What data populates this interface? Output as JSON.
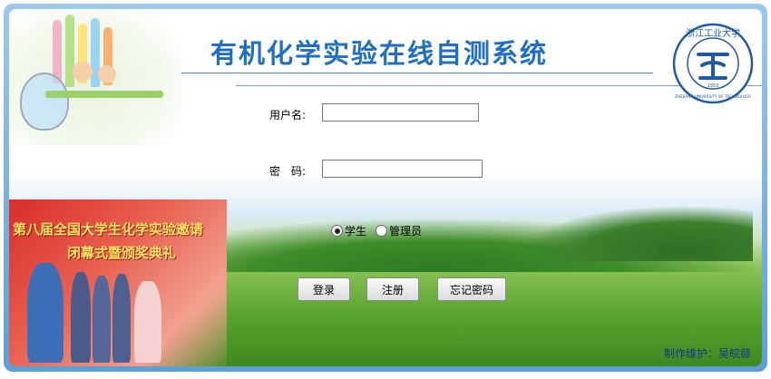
{
  "header": {
    "title": "有机化学实验在线自测系统",
    "logo_text": "浙江工业大学",
    "logo_year": "1953",
    "logo_en": "ZHEJIANG UNIVERSITY OF TECHNOLOGY"
  },
  "banner": {
    "line1": "第八届全国大学生化学实验邀请",
    "line2": "闭幕式暨颁奖典礼"
  },
  "form": {
    "username_label": "用户名:",
    "username_value": "",
    "password_label": "密　码:",
    "password_value": "",
    "role_options": [
      "学生",
      "管理员"
    ],
    "role_selected": "学生"
  },
  "buttons": {
    "login": "登录",
    "register": "注册",
    "forgot": "忘记密码"
  },
  "footer": {
    "credit": "制作维护：吴皖赣"
  },
  "colors": {
    "title": "#1f6fc6",
    "frame": "#5b9fd4",
    "footer": "#103a8a"
  }
}
